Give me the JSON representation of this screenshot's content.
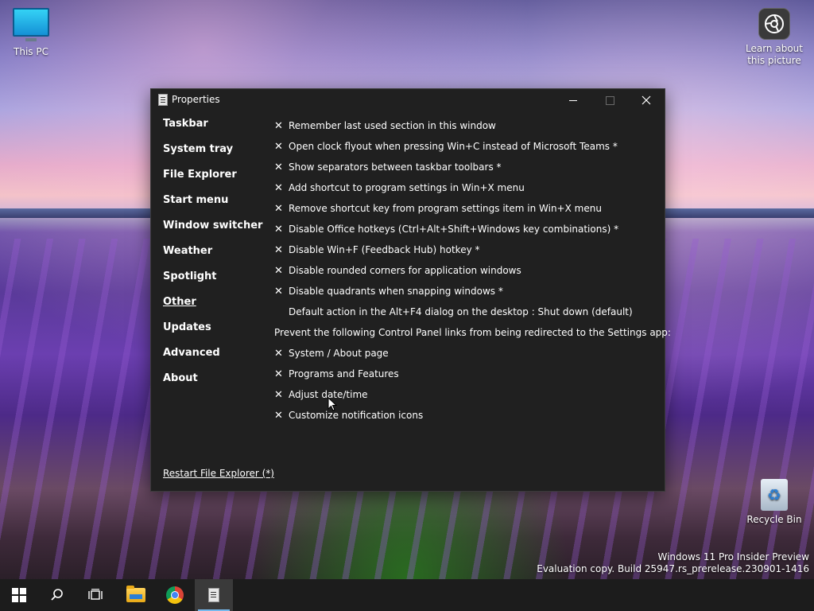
{
  "desktop": {
    "icons": [
      {
        "label": "This PC"
      },
      {
        "label": "Learn about this picture"
      },
      {
        "label": "Recycle Bin"
      }
    ],
    "watermark": {
      "line1": "Windows 11 Pro Insider Preview",
      "line2": "Evaluation copy. Build 25947.rs_prerelease.230901-1416"
    }
  },
  "window": {
    "title": "Properties",
    "controls": {
      "minimize_icon": "minimize-icon",
      "maximize_icon": "maximize-icon",
      "close_icon": "close-icon"
    },
    "sidebar": {
      "items": [
        {
          "label": "Taskbar"
        },
        {
          "label": "System tray"
        },
        {
          "label": "File Explorer"
        },
        {
          "label": "Start menu"
        },
        {
          "label": "Window switcher"
        },
        {
          "label": "Weather"
        },
        {
          "label": "Spotlight"
        },
        {
          "label": "Other",
          "active": true
        },
        {
          "label": "Updates"
        },
        {
          "label": "Advanced"
        },
        {
          "label": "About"
        }
      ],
      "restart_link": "Restart File Explorer (*)"
    },
    "settings": [
      {
        "checked": true,
        "label": "Remember last used section in this window"
      },
      {
        "checked": true,
        "label": "Open clock flyout when pressing Win+C instead of Microsoft Teams *"
      },
      {
        "checked": true,
        "label": "Show separators between taskbar toolbars *"
      },
      {
        "checked": true,
        "label": "Add shortcut to program settings in Win+X menu"
      },
      {
        "checked": true,
        "label": "Remove shortcut key from program settings item in Win+X menu"
      },
      {
        "checked": true,
        "label": "Disable Office hotkeys (Ctrl+Alt+Shift+Windows key combinations) *"
      },
      {
        "checked": true,
        "label": "Disable Win+F (Feedback Hub) hotkey *"
      },
      {
        "checked": true,
        "label": "Disable rounded corners for application windows"
      },
      {
        "checked": true,
        "label": "Disable quadrants when snapping windows *"
      },
      {
        "checked": false,
        "label": "Default action in the Alt+F4 dialog on the desktop : Shut down (default)"
      },
      {
        "heading": true,
        "label": "Prevent the following Control Panel links from being redirected to the Settings app:"
      },
      {
        "checked": true,
        "label": "System / About page"
      },
      {
        "checked": true,
        "label": "Programs and Features"
      },
      {
        "checked": true,
        "label": "Adjust date/time"
      },
      {
        "checked": true,
        "label": "Customize notification icons"
      }
    ],
    "check_glyph": "✕"
  },
  "taskbar": {
    "items": [
      "start-icon",
      "search-icon",
      "task-view-icon",
      "file-explorer-icon",
      "chrome-icon",
      "properties-icon"
    ],
    "accent_color": "#76b9ed"
  }
}
